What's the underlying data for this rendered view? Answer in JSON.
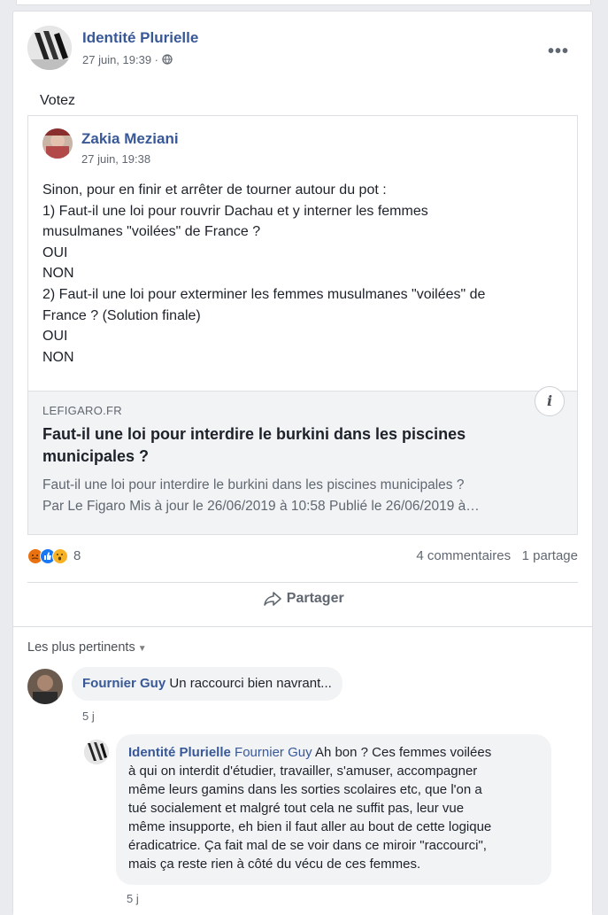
{
  "post": {
    "author": "Identité Plurielle",
    "time": "27 juin, 19:39 · ",
    "text": "Votez",
    "menu": "•••"
  },
  "shared": {
    "author": "Zakia Meziani",
    "time": "27 juin, 19:38",
    "lines": [
      "Sinon, pour en finir et arrêter de tourner autour du pot :",
      "1) Faut-il une loi pour rouvrir Dachau et y interner les femmes",
      "musulmanes \"voilées\" de France ?",
      "OUI",
      "NON",
      "2) Faut-il une loi pour exterminer les femmes musulmanes \"voilées\" de",
      "France ? (Solution finale)",
      "OUI",
      "NON"
    ],
    "link": {
      "domain": "LEFIGARO.FR",
      "title": "Faut-il une loi pour interdire le burkini dans les piscines municipales ?",
      "desc1": "Faut-il une loi pour interdire le burkini dans les piscines municipales ?",
      "desc2": "Par Le Figaro Mis à jour le 26/06/2019 à 10:58 Publié le 26/06/2019 à…",
      "info": "i"
    }
  },
  "stats": {
    "reaction_count": "8",
    "comments": "4 commentaires",
    "shares": "1 partage"
  },
  "actions": {
    "share_label": "Partager"
  },
  "comments": {
    "sort_label": "Les plus pertinents",
    "items": [
      {
        "name": "Fournier Guy",
        "text": "Un raccourci bien navrant...",
        "time": "5 j"
      },
      {
        "name": "Identité Plurielle",
        "mention": "Fournier Guy",
        "lines": [
          "Ah bon ? Ces femmes voilées",
          "à qui on interdit d'étudier, travailler, s'amuser, accompagner",
          "même leurs gamins dans les sorties scolaires etc, que l'on a",
          "tué socialement et malgré tout cela ne suffit pas, leur vue",
          "même insupporte, eh bien il faut aller au bout de cette logique",
          "éradicatrice. Ça fait mal de se voir dans ce miroir \"raccourci\",",
          "mais ça reste rien à côté du vécu de ces femmes."
        ],
        "time": "5 j"
      }
    ]
  },
  "colors": {
    "link": "#385898",
    "text": "#1d2129",
    "muted": "#606770",
    "bubble": "#f2f3f5"
  },
  "icons": [
    "globe-icon",
    "share-arrow-icon",
    "angry-reaction-icon",
    "like-reaction-icon",
    "wow-reaction-icon",
    "info-icon",
    "more-options-icon"
  ]
}
